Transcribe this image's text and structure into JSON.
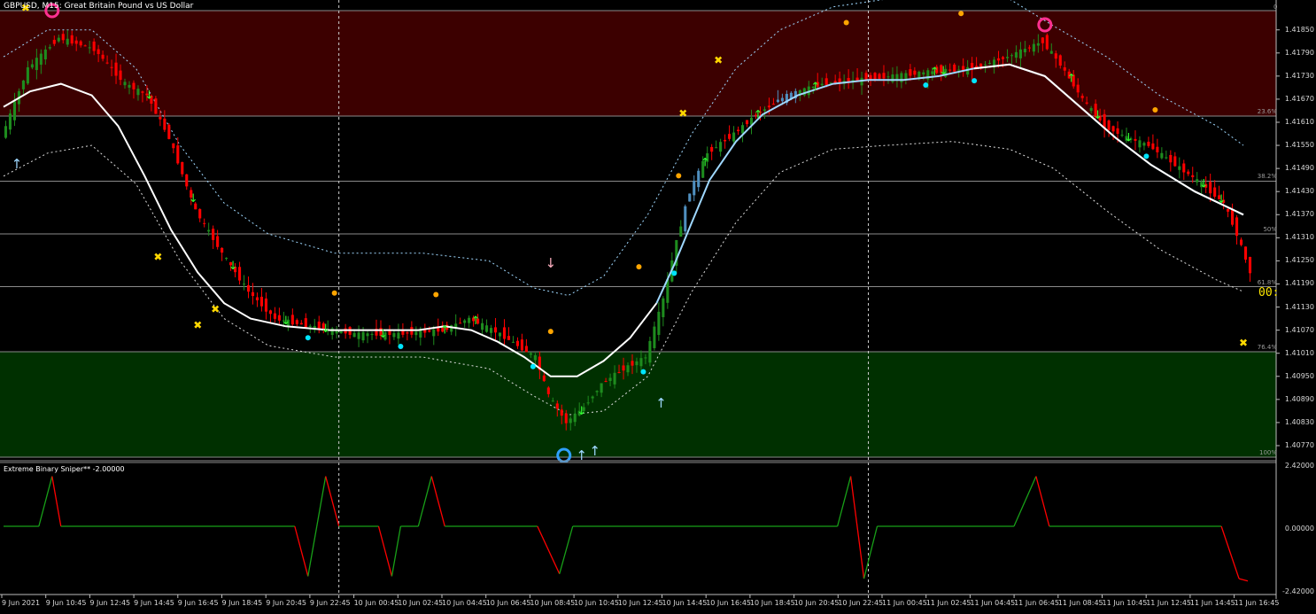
{
  "window": {
    "title": "GBPUSD, M15:  Great Britain Pound vs US Dollar",
    "corner_zero": "0",
    "countdown": "00:"
  },
  "indicator": {
    "title": "Extreme Binary Sniper** -2.00000",
    "ticks": [
      "2.42000",
      "0.00000",
      "-2.42000"
    ]
  },
  "colors": {
    "bear_zone": "#3c0000",
    "bull_zone": "#003000",
    "bull_candle": "#1e8c1e",
    "bear_candle": "#ff0000",
    "blue_candle": "#4f8fbf",
    "ma_line": "#ffffff",
    "ma_tail": "#9fd8ff",
    "band": "#9fd8ff",
    "osc_up": "#18a018",
    "osc_down": "#ff0000"
  },
  "chart_data": [
    {
      "type": "candlestick",
      "symbol": "GBPUSD",
      "timeframe": "M15",
      "price_axis": [
        "1.41850",
        "1.41790",
        "1.41730",
        "1.41670",
        "1.41610",
        "1.41550",
        "1.41490",
        "1.41430",
        "1.41370",
        "1.41310",
        "1.41250",
        "1.41190",
        "1.41130",
        "1.41070",
        "1.41010",
        "1.40950",
        "1.40890",
        "1.40830",
        "1.40770"
      ],
      "time_axis": [
        "9 Jun 2021",
        "9 Jun 10:45",
        "9 Jun 12:45",
        "9 Jun 14:45",
        "9 Jun 16:45",
        "9 Jun 18:45",
        "9 Jun 20:45",
        "9 Jun 22:45",
        "10 Jun 00:45",
        "10 Jun 02:45",
        "10 Jun 04:45",
        "10 Jun 06:45",
        "10 Jun 08:45",
        "10 Jun 10:45",
        "10 Jun 12:45",
        "10 Jun 14:45",
        "10 Jun 16:45",
        "10 Jun 18:45",
        "10 Jun 20:45",
        "10 Jun 22:45",
        "11 Jun 00:45",
        "11 Jun 02:45",
        "11 Jun 04:45",
        "11 Jun 06:45",
        "11 Jun 08:45",
        "11 Jun 10:45",
        "11 Jun 12:45",
        "11 Jun 14:45",
        "11 Jun 16:45"
      ],
      "ylim": [
        1.4074,
        1.419
      ],
      "fib_levels": [
        {
          "label": "0",
          "price": 1.419
        },
        {
          "label": "23.6%",
          "price": 1.41626
        },
        {
          "label": "38.2%",
          "price": 1.41457
        },
        {
          "label": "50%",
          "price": 1.4132
        },
        {
          "label": "61.8%",
          "price": 1.41183
        },
        {
          "label": "76.4%",
          "price": 1.41014
        },
        {
          "label": "100%",
          "price": 1.4074
        }
      ],
      "close_path": [
        [
          0,
          1.4157
        ],
        [
          6,
          1.4175
        ],
        [
          13,
          1.4183
        ],
        [
          21,
          1.418
        ],
        [
          28,
          1.4171
        ],
        [
          33,
          1.4168
        ],
        [
          38,
          1.4157
        ],
        [
          44,
          1.4138
        ],
        [
          50,
          1.4127
        ],
        [
          56,
          1.4117
        ],
        [
          62,
          1.411
        ],
        [
          70,
          1.4108
        ],
        [
          80,
          1.4106
        ],
        [
          90,
          1.4106
        ],
        [
          100,
          1.4107
        ],
        [
          106,
          1.411
        ],
        [
          113,
          1.4106
        ],
        [
          121,
          1.41
        ],
        [
          124,
          1.409
        ],
        [
          128,
          1.4083
        ],
        [
          132,
          1.4087
        ],
        [
          136,
          1.4093
        ],
        [
          141,
          1.4097
        ],
        [
          146,
          1.41
        ],
        [
          150,
          1.4115
        ],
        [
          153,
          1.413
        ],
        [
          156,
          1.4143
        ],
        [
          160,
          1.4153
        ],
        [
          166,
          1.4158
        ],
        [
          171,
          1.4163
        ],
        [
          178,
          1.4168
        ],
        [
          186,
          1.4171
        ],
        [
          194,
          1.4172
        ],
        [
          202,
          1.4173
        ],
        [
          210,
          1.4174
        ],
        [
          220,
          1.4175
        ],
        [
          228,
          1.4178
        ],
        [
          236,
          1.4182
        ],
        [
          240,
          1.4176
        ],
        [
          245,
          1.4167
        ],
        [
          250,
          1.416
        ],
        [
          255,
          1.4157
        ],
        [
          260,
          1.4155
        ],
        [
          266,
          1.415
        ],
        [
          272,
          1.4145
        ],
        [
          277,
          1.414
        ],
        [
          280,
          1.4132
        ],
        [
          283,
          1.4122
        ]
      ],
      "ma_path": [
        [
          0,
          1.4165
        ],
        [
          6,
          1.4169
        ],
        [
          13,
          1.4171
        ],
        [
          20,
          1.4168
        ],
        [
          26,
          1.416
        ],
        [
          32,
          1.4147
        ],
        [
          38,
          1.4133
        ],
        [
          44,
          1.4122
        ],
        [
          50,
          1.4114
        ],
        [
          56,
          1.411
        ],
        [
          64,
          1.4108
        ],
        [
          74,
          1.4107
        ],
        [
          84,
          1.4107
        ],
        [
          94,
          1.4107
        ],
        [
          100,
          1.4108
        ],
        [
          106,
          1.4107
        ],
        [
          112,
          1.4104
        ],
        [
          118,
          1.41
        ],
        [
          124,
          1.4095
        ],
        [
          130,
          1.4095
        ],
        [
          136,
          1.4099
        ],
        [
          142,
          1.4105
        ],
        [
          148,
          1.4114
        ],
        [
          152,
          1.4124
        ],
        [
          156,
          1.4135
        ],
        [
          160,
          1.4146
        ],
        [
          166,
          1.4156
        ],
        [
          172,
          1.4163
        ],
        [
          180,
          1.4168
        ],
        [
          188,
          1.4171
        ],
        [
          196,
          1.4172
        ],
        [
          204,
          1.4172
        ],
        [
          212,
          1.4173
        ],
        [
          220,
          1.4175
        ],
        [
          228,
          1.4176
        ],
        [
          236,
          1.4173
        ],
        [
          244,
          1.4165
        ],
        [
          252,
          1.4157
        ],
        [
          260,
          1.415
        ],
        [
          270,
          1.4143
        ],
        [
          281,
          1.4137
        ]
      ],
      "band_upper": [
        [
          0,
          1.4178
        ],
        [
          10,
          1.4185
        ],
        [
          20,
          1.4185
        ],
        [
          30,
          1.4175
        ],
        [
          40,
          1.4155
        ],
        [
          50,
          1.414
        ],
        [
          60,
          1.4132
        ],
        [
          75,
          1.4127
        ],
        [
          95,
          1.4127
        ],
        [
          110,
          1.4125
        ],
        [
          120,
          1.4118
        ],
        [
          128,
          1.4116
        ],
        [
          136,
          1.4121
        ],
        [
          146,
          1.4137
        ],
        [
          156,
          1.4158
        ],
        [
          166,
          1.4175
        ],
        [
          176,
          1.4185
        ],
        [
          188,
          1.4191
        ],
        [
          200,
          1.4193
        ],
        [
          215,
          1.4194
        ],
        [
          228,
          1.4193
        ],
        [
          238,
          1.4186
        ],
        [
          250,
          1.4178
        ],
        [
          262,
          1.4168
        ],
        [
          275,
          1.416
        ],
        [
          281,
          1.4155
        ]
      ],
      "band_lower": [
        [
          0,
          1.4147
        ],
        [
          10,
          1.4153
        ],
        [
          20,
          1.4155
        ],
        [
          30,
          1.4145
        ],
        [
          40,
          1.4125
        ],
        [
          50,
          1.411
        ],
        [
          60,
          1.4103
        ],
        [
          75,
          1.41
        ],
        [
          95,
          1.41
        ],
        [
          110,
          1.4097
        ],
        [
          120,
          1.409
        ],
        [
          128,
          1.4085
        ],
        [
          136,
          1.4086
        ],
        [
          146,
          1.4095
        ],
        [
          156,
          1.4117
        ],
        [
          166,
          1.4135
        ],
        [
          176,
          1.4148
        ],
        [
          188,
          1.4154
        ],
        [
          200,
          1.4155
        ],
        [
          215,
          1.4156
        ],
        [
          228,
          1.4154
        ],
        [
          238,
          1.4149
        ],
        [
          250,
          1.4138
        ],
        [
          262,
          1.4128
        ],
        [
          275,
          1.412
        ],
        [
          281,
          1.4117
        ]
      ]
    },
    {
      "type": "line",
      "title": "Extreme Binary Sniper** -2.00000",
      "ylim": [
        -2.42,
        2.42
      ],
      "keypoints": [
        [
          0,
          0
        ],
        [
          8,
          0
        ],
        [
          11,
          2.1
        ],
        [
          13,
          0
        ],
        [
          66,
          0
        ],
        [
          69,
          -2.1
        ],
        [
          71,
          0
        ],
        [
          71,
          0
        ],
        [
          73,
          2.1
        ],
        [
          76,
          0
        ],
        [
          85,
          0
        ],
        [
          88,
          -2.1
        ],
        [
          90,
          0
        ],
        [
          94,
          0
        ],
        [
          97,
          2.1
        ],
        [
          100,
          0
        ],
        [
          121,
          0
        ],
        [
          126,
          -2.0
        ],
        [
          129,
          0
        ],
        [
          189,
          0
        ],
        [
          192,
          2.1
        ],
        [
          195,
          -2.2
        ],
        [
          198,
          0
        ],
        [
          229,
          0
        ],
        [
          234,
          2.1
        ],
        [
          237,
          0
        ],
        [
          276,
          0
        ],
        [
          280,
          -2.2
        ],
        [
          282,
          -2.3
        ]
      ]
    }
  ]
}
